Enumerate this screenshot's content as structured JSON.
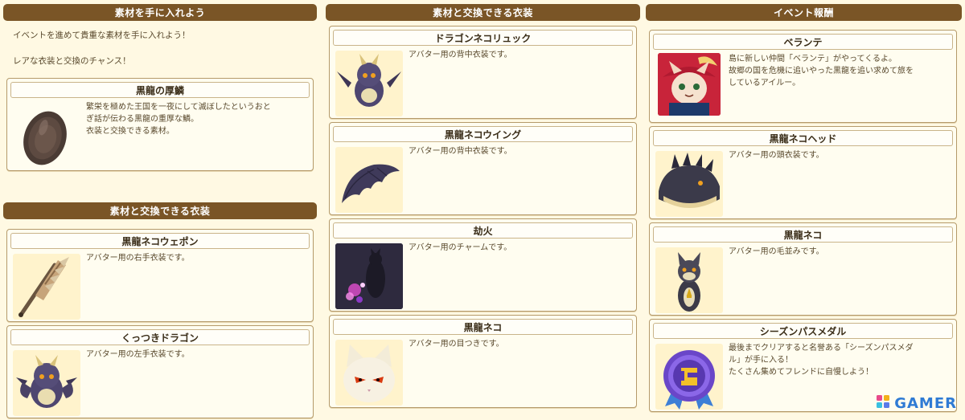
{
  "material_section": {
    "heading": "素材を手に入れよう",
    "intro_line1": "イベントを進めて貴重な素材を手に入れよう！",
    "intro_line2": "レアな衣装と交換のチャンス！",
    "items": [
      {
        "title": "黒龍の厚鱗",
        "desc": "繁栄を極めた王国を一夜にして滅ぼしたというおと\nぎ話が伝わる黒龍の重厚な鱗。\n衣装と交換できる素材。",
        "icon": "scale-icon"
      }
    ]
  },
  "exchange_left": {
    "heading": "素材と交換できる衣装",
    "items": [
      {
        "title": "黒龍ネコウェポン",
        "desc": "アバター用の右手衣装です。",
        "icon": "spiked-club-icon"
      },
      {
        "title": "くっつきドラゴン",
        "desc": "アバター用の左手衣装です。",
        "icon": "dragon-plush-icon"
      }
    ]
  },
  "exchange_center": {
    "heading": "素材と交換できる衣装",
    "items": [
      {
        "title": "ドラゴンネコリュック",
        "desc": "アバター用の背中衣装です。",
        "icon": "dragon-backpack-icon"
      },
      {
        "title": "黒龍ネコウイング",
        "desc": "アバター用の背中衣装です。",
        "icon": "wing-icon"
      },
      {
        "title": "劫火",
        "desc": "アバター用のチャームです。",
        "icon": "flame-charm-icon"
      },
      {
        "title": "黒龍ネコ",
        "desc": "アバター用の目つきです。",
        "icon": "cat-eyes-icon"
      }
    ]
  },
  "event_rewards": {
    "heading": "イベント報酬",
    "items": [
      {
        "title": "ベランテ",
        "desc": "島に新しい仲間「ベランテ」がやってくるよ。\n故郷の国を危機に追いやった黒龍を追い求めて旅を\nしているアイルー。",
        "icon": "verante-portrait-icon"
      },
      {
        "title": "黒龍ネコヘッド",
        "desc": "アバター用の頭衣装です。",
        "icon": "dragon-head-icon"
      },
      {
        "title": "黒龍ネコ",
        "desc": "アバター用の毛並みです。",
        "icon": "cat-fur-icon"
      },
      {
        "title": "シーズンパスメダル",
        "desc": "最後までクリアすると名誉ある「シーズンパスメダ\nル」が手に入る！\nたくさん集めてフレンドに自慢しよう！",
        "icon": "medal-icon"
      }
    ]
  },
  "watermark": {
    "text": "GAMER",
    "icon": "gamer-logo-icon"
  },
  "colors": {
    "banner": "#7a5526",
    "background": "#fff9e3",
    "card_border": "#b59a6a",
    "watermark": "#2f7bd4"
  }
}
